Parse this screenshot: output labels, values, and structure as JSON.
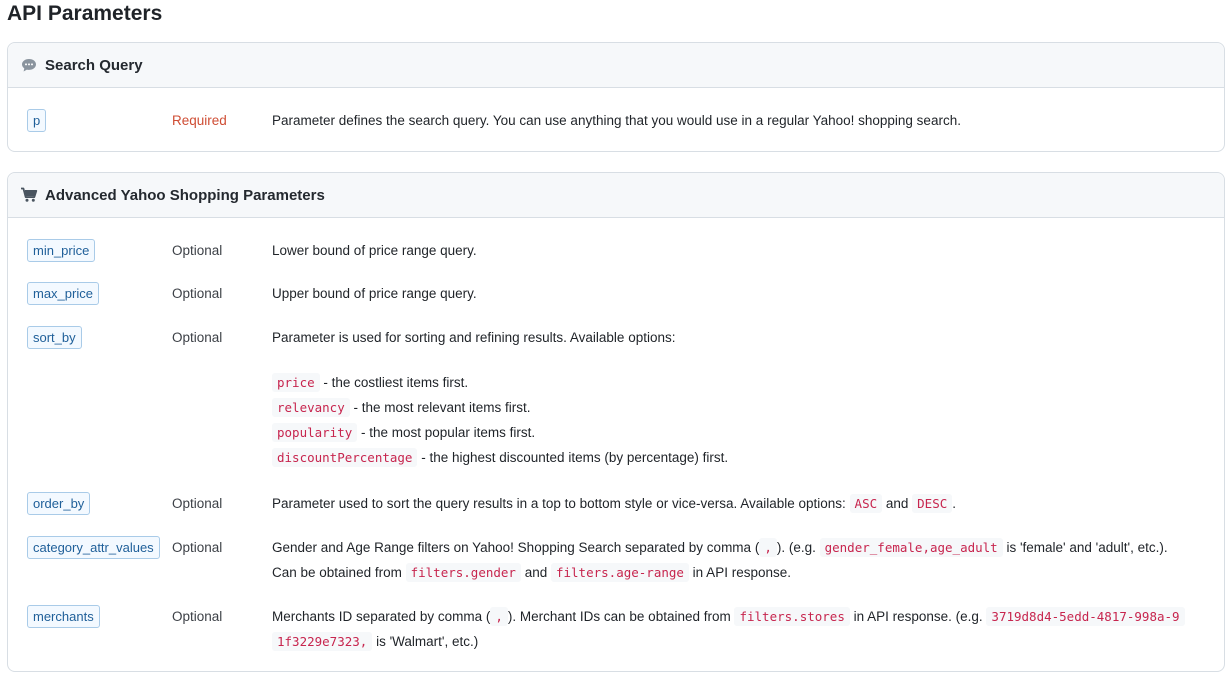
{
  "page_title": "API Parameters",
  "search_query": {
    "title": "Search Query",
    "icon": "speech-bubble-icon",
    "param": {
      "name": "p",
      "requirement": "Required",
      "description": "Parameter defines the search query. You can use anything that you would use in a regular Yahoo! shopping search."
    }
  },
  "advanced": {
    "title": "Advanced Yahoo Shopping Parameters",
    "icon": "shopping-cart-icon",
    "params": [
      {
        "name": "min_price",
        "requirement": "Optional",
        "description": "Lower bound of price range query."
      },
      {
        "name": "max_price",
        "requirement": "Optional",
        "description": "Upper bound of price range query."
      },
      {
        "name": "sort_by",
        "requirement": "Optional",
        "description": "Parameter is used for sorting and refining results. Available options:",
        "options": [
          {
            "code": "price",
            "text": " - the costliest items first."
          },
          {
            "code": "relevancy",
            "text": " - the most relevant items first."
          },
          {
            "code": "popularity",
            "text": " - the most popular items first."
          },
          {
            "code": "discountPercentage",
            "text": " - the highest discounted items (by percentage) first."
          }
        ]
      },
      {
        "name": "order_by",
        "requirement": "Optional",
        "description_pre": "Parameter used to sort the query results in a top to bottom style or vice-versa. Available options: ",
        "code1": "ASC",
        "mid": " and ",
        "code2": "DESC",
        "post": "."
      },
      {
        "name": "category_attr_values",
        "requirement": "Optional",
        "line1_pre": "Gender and Age Range filters on Yahoo! Shopping Search separated by comma (",
        "line1_code1": ",",
        "line1_mid": "). (e.g. ",
        "line1_code2": "gender_female,age_adult",
        "line1_post": " is 'female' and 'adult', etc.).",
        "line2_pre": "Can be obtained from ",
        "line2_code1": "filters.gender",
        "line2_mid": " and ",
        "line2_code2": "filters.age-range",
        "line2_post": " in API response."
      },
      {
        "name": "merchants",
        "requirement": "Optional",
        "pre": "Merchants ID separated by comma (",
        "code1": ",",
        "mid1": "). Merchant IDs can be obtained from ",
        "code2": "filters.stores",
        "mid2": " in API response. (e.g. ",
        "code3a": "3719d8d4-5edd-4817-998a-9",
        "code3b": "1f3229e7323,",
        "post": " is 'Walmart', etc.)"
      }
    ]
  }
}
